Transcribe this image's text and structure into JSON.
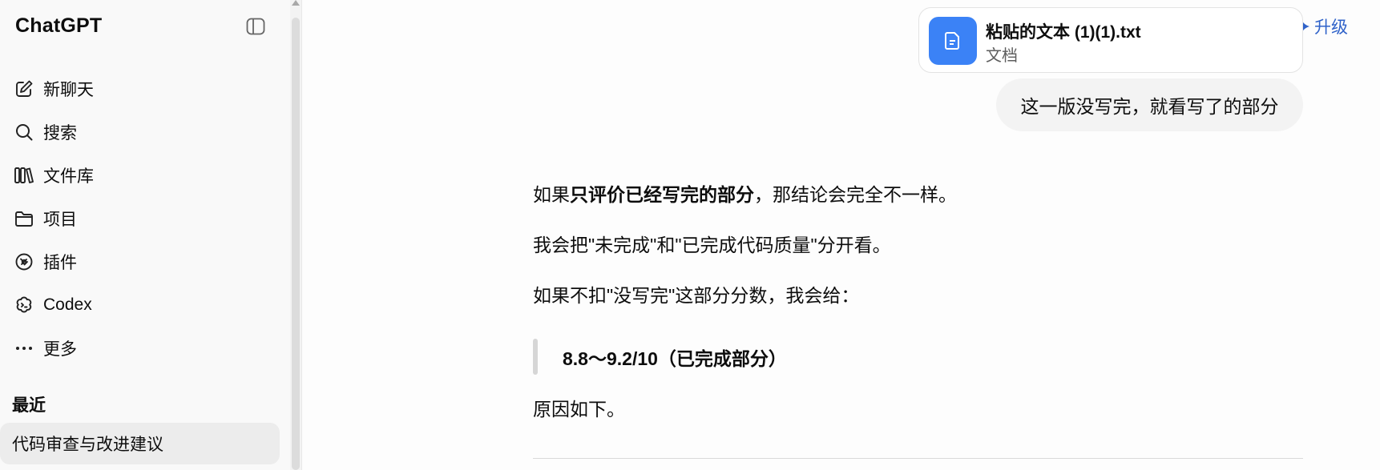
{
  "sidebar": {
    "brand": "ChatGPT",
    "nav": [
      {
        "label": "新聊天",
        "icon": "edit-icon"
      },
      {
        "label": "搜索",
        "icon": "search-icon"
      },
      {
        "label": "文件库",
        "icon": "library-icon"
      },
      {
        "label": "项目",
        "icon": "folder-icon"
      },
      {
        "label": "插件",
        "icon": "plugin-icon"
      },
      {
        "label": "Codex",
        "icon": "codex-icon"
      },
      {
        "label": "更多",
        "icon": "more-icon"
      }
    ],
    "recent_title": "最近",
    "recent_items": [
      {
        "label": "代码审查与改进建议"
      }
    ]
  },
  "header": {
    "upgrade_label": "升级",
    "accent": "#2f62c9"
  },
  "attachment": {
    "name": "粘贴的文本 (1)(1).txt",
    "type": "文档",
    "icon_color": "#3b82f6"
  },
  "user_message": "这一版没写完，就看写了的部分",
  "assistant": {
    "p1_prefix": "如果",
    "p1_bold": "只评价已经写完的部分",
    "p1_suffix": "，那结论会完全不一样。",
    "p2": "我会把\"未完成\"和\"已完成代码质量\"分开看。",
    "p3": "如果不扣\"没写完\"这部分分数，我会给：",
    "quote": "8.8～9.2/10（已完成部分）",
    "p4": "原因如下。"
  }
}
